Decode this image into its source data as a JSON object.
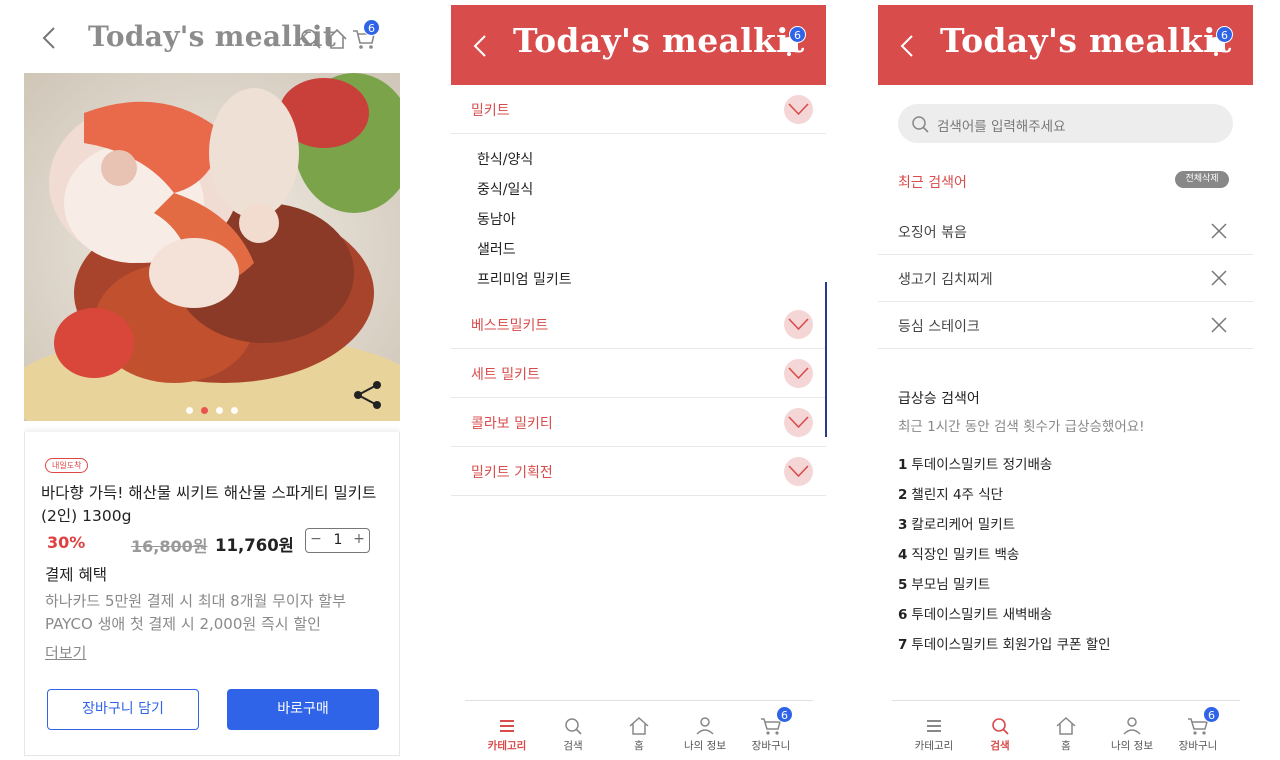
{
  "brand_title": "Today's mealkit",
  "colors": {
    "accent": "#d94c4c",
    "primary_blue": "#2f63e8",
    "badge": "#2f63e8"
  },
  "cart_count": "6",
  "bell_count": "6",
  "product": {
    "dots_count": 4,
    "active_dot": 1,
    "delivery_tag": "내일도착",
    "name": "바다향 가득! 해산물 씨키트 해산물 스파게티 밀키트 (2인) 1300g",
    "discount": "30%",
    "original_price": "16,800원",
    "sale_price": "11,760원",
    "quantity": "1",
    "benefit_title": "결제 혜택",
    "benefits": [
      "하나카드 5만원 결제 시 최대 8개월 무이자 할부",
      "PAYCO 생애 첫 결제 시 2,000원 즉시 할인"
    ],
    "more_label": "더보기",
    "cart_button": "장바구니 담기",
    "buy_button": "바로구매"
  },
  "categories": {
    "groups": [
      "밀키트",
      "베스트밀키트",
      "세트 밀키트",
      "콜라보 밀키티",
      "밀키트 기획전"
    ],
    "sub_items": [
      "한식/양식",
      "중식/일식",
      "동남아",
      "샐러드",
      "프리미엄 밀키트"
    ]
  },
  "search": {
    "placeholder": "검색어를 입력해주세요",
    "recent_title": "최근 검색어",
    "delete_all": "전체삭제",
    "recent": [
      "오징어 볶음",
      "생고기 김치찌게",
      "등심 스테이크"
    ],
    "rising_title": "급상승 검색어",
    "rising_subtitle": "최근 1시간 동안 검색 횟수가 급상승했어요!",
    "rising": [
      {
        "rank": "1",
        "term": "투데이스밀키트 정기배송"
      },
      {
        "rank": "2",
        "term": "챌린지 4주 식단"
      },
      {
        "rank": "3",
        "term": "칼로리케어 밀키트"
      },
      {
        "rank": "4",
        "term": "직장인 밀키트 백송"
      },
      {
        "rank": "5",
        "term": "부모님 밀키트"
      },
      {
        "rank": "6",
        "term": "투데이스밀키트 새벽배송"
      },
      {
        "rank": "7",
        "term": "투데이스밀키트 회원가입 쿠폰 할인"
      }
    ]
  },
  "tabs": [
    "카테고리",
    "검색",
    "홈",
    "나의 정보",
    "장바구니"
  ]
}
